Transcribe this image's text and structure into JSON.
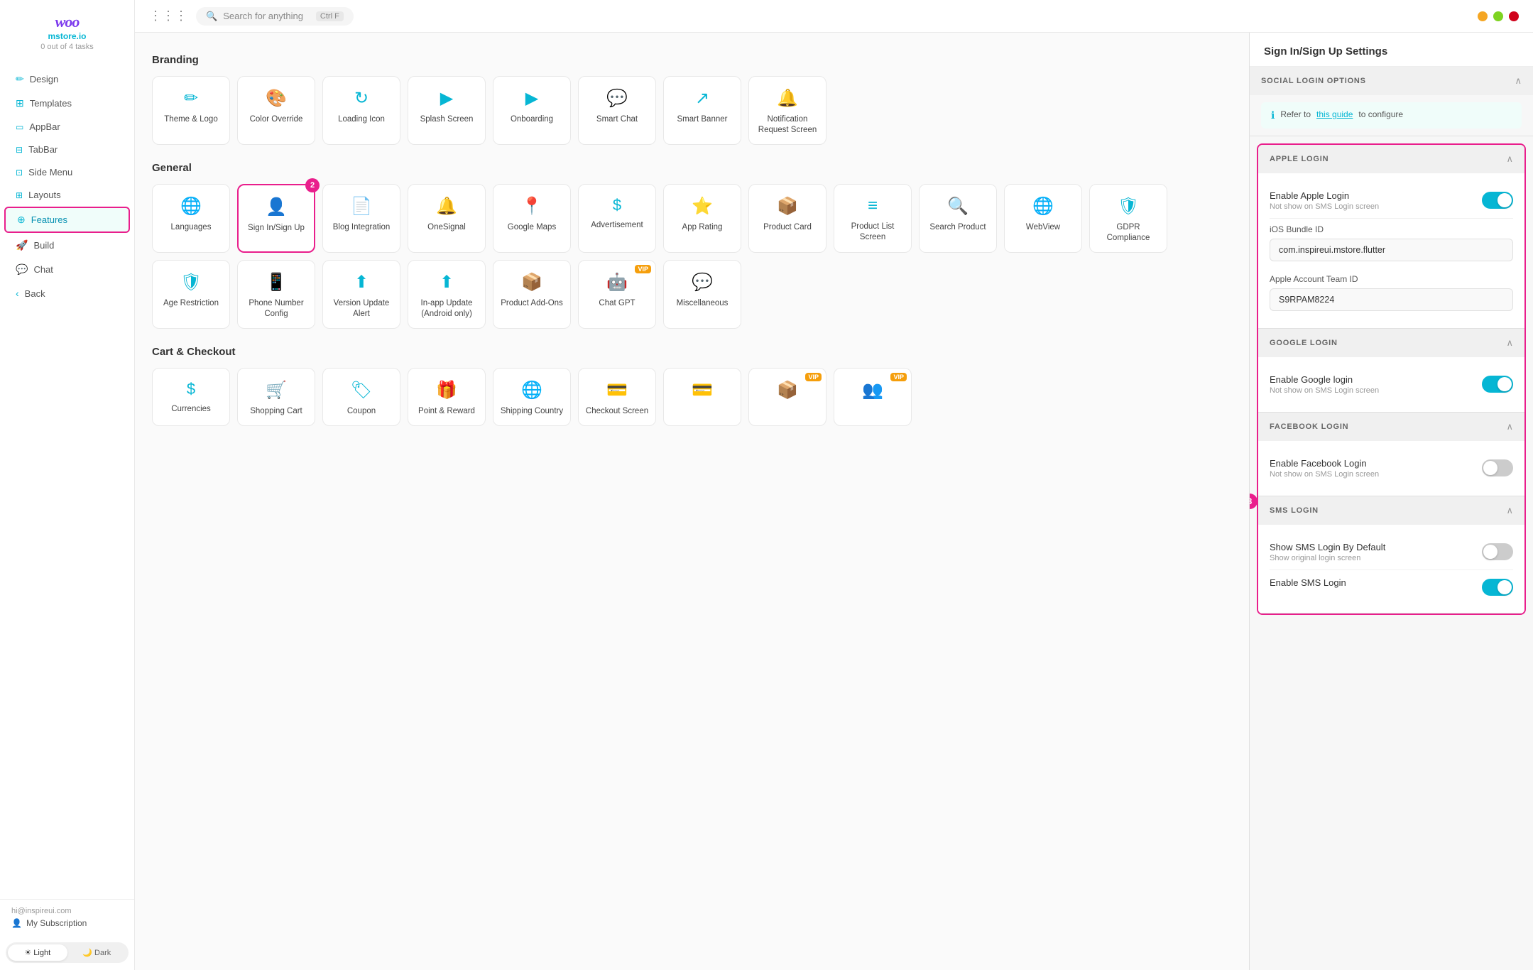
{
  "topbar": {
    "search_placeholder": "Search for anything",
    "shortcut": "Ctrl F",
    "win_buttons": [
      "minimize",
      "maximize",
      "close"
    ]
  },
  "sidebar": {
    "logo": "woo",
    "site": "mstore.io",
    "tasks": "0 out of 4 tasks",
    "nav_items": [
      {
        "id": "design",
        "label": "Design",
        "icon": "✏️"
      },
      {
        "id": "templates",
        "label": "Templates",
        "icon": "⊞"
      },
      {
        "id": "appbar",
        "label": "AppBar",
        "icon": "▭"
      },
      {
        "id": "tabbar",
        "label": "TabBar",
        "icon": "⊟"
      },
      {
        "id": "sidemenu",
        "label": "Side Menu",
        "icon": "⊡"
      },
      {
        "id": "layouts",
        "label": "Layouts",
        "icon": "⊞"
      },
      {
        "id": "features",
        "label": "Features",
        "icon": "⊕",
        "active": true
      },
      {
        "id": "build",
        "label": "Build",
        "icon": "🚀"
      },
      {
        "id": "chat",
        "label": "Chat",
        "icon": "💬"
      },
      {
        "id": "back",
        "label": "Back",
        "icon": "‹"
      }
    ],
    "footer_email": "hi@inspireui.com",
    "subscription_label": "My Subscription",
    "theme_light": "☀ Light",
    "theme_dark": "🌙 Dark"
  },
  "branding": {
    "title": "Branding",
    "items": [
      {
        "id": "theme-logo",
        "label": "Theme & Logo",
        "icon": "✏"
      },
      {
        "id": "color-override",
        "label": "Color Override",
        "icon": "🎨"
      },
      {
        "id": "loading-icon",
        "label": "Loading Icon",
        "icon": "↻"
      },
      {
        "id": "splash-screen",
        "label": "Splash Screen",
        "icon": "▶"
      },
      {
        "id": "onboarding",
        "label": "Onboarding",
        "icon": "▶"
      },
      {
        "id": "smart-chat",
        "label": "Smart Chat",
        "icon": "💬"
      },
      {
        "id": "smart-banner",
        "label": "Smart Banner",
        "icon": "↗"
      },
      {
        "id": "notification-request",
        "label": "Notification Request Screen",
        "icon": "🔔"
      }
    ]
  },
  "general": {
    "title": "General",
    "items": [
      {
        "id": "languages",
        "label": "Languages",
        "icon": "🌐"
      },
      {
        "id": "sign-in-up",
        "label": "Sign In/Sign Up",
        "icon": "👤",
        "selected": true,
        "step": "2"
      },
      {
        "id": "blog-integration",
        "label": "Blog Integration",
        "icon": "📄"
      },
      {
        "id": "onesignal",
        "label": "OneSignal",
        "icon": "🔔"
      },
      {
        "id": "google-maps",
        "label": "Google Maps",
        "icon": "📍"
      },
      {
        "id": "advertisement",
        "label": "Advertisement",
        "icon": "$"
      },
      {
        "id": "app-rating",
        "label": "App Rating",
        "icon": "⭐"
      },
      {
        "id": "product-card",
        "label": "Product Card",
        "icon": "📦"
      },
      {
        "id": "product-list",
        "label": "Product List Screen",
        "icon": "≡"
      },
      {
        "id": "search-product",
        "label": "Search Product",
        "icon": "🔍"
      },
      {
        "id": "webview",
        "label": "WebView",
        "icon": "🌐"
      },
      {
        "id": "gdpr",
        "label": "GDPR Compliance",
        "icon": "🛡"
      },
      {
        "id": "age-restriction",
        "label": "Age Restriction",
        "icon": "🛡"
      },
      {
        "id": "phone-number",
        "label": "Phone Number Config",
        "icon": "📱"
      },
      {
        "id": "version-update",
        "label": "Version Update Alert",
        "icon": "⬆"
      },
      {
        "id": "in-app-update",
        "label": "In-app Update (Android only)",
        "icon": "⬆"
      },
      {
        "id": "product-addons",
        "label": "Product Add-Ons",
        "icon": "📦"
      },
      {
        "id": "chat-gpt",
        "label": "Chat GPT",
        "icon": "🤖",
        "vip": true
      },
      {
        "id": "miscellaneous",
        "label": "Miscellaneous",
        "icon": "💬"
      }
    ]
  },
  "cart_checkout": {
    "title": "Cart & Checkout",
    "items": [
      {
        "id": "currencies",
        "label": "Currencies",
        "icon": "$"
      },
      {
        "id": "shopping-cart",
        "label": "Shopping Cart",
        "icon": "🛒"
      },
      {
        "id": "coupon",
        "label": "Coupon",
        "icon": "🏷"
      },
      {
        "id": "point-reward",
        "label": "Point & Reward",
        "icon": "🎁"
      },
      {
        "id": "shipping-country",
        "label": "Shipping Country",
        "icon": "🌐"
      },
      {
        "id": "checkout-screen",
        "label": "Checkout Screen",
        "icon": "💳"
      },
      {
        "id": "item7",
        "label": "",
        "icon": "💳"
      },
      {
        "id": "item8",
        "label": "",
        "icon": "📦",
        "vip": true
      },
      {
        "id": "item9",
        "label": "",
        "icon": "👥",
        "vip": true
      }
    ]
  },
  "right_panel": {
    "title": "Sign In/Sign Up Settings",
    "social_login_title": "SOCIAL LOGIN OPTIONS",
    "social_info_text": "Refer to ",
    "social_link_text": "this guide",
    "social_info_suffix": " to configure",
    "apple_login": {
      "section_title": "APPLE LOGIN",
      "enable_label": "Enable Apple Login",
      "enable_sub": "Not show on SMS Login screen",
      "enable_value": true,
      "bundle_id_label": "iOS Bundle ID",
      "bundle_id_value": "com.inspireui.mstore.flutter",
      "team_id_label": "Apple Account Team ID",
      "team_id_value": "S9RPAM8224"
    },
    "google_login": {
      "section_title": "GOOGLE LOGIN",
      "enable_label": "Enable Google login",
      "enable_sub": "Not show on SMS Login screen",
      "enable_value": true
    },
    "facebook_login": {
      "section_title": "FACEBOOK LOGIN",
      "enable_label": "Enable Facebook Login",
      "enable_sub": "Not show on SMS Login screen",
      "enable_value": false
    },
    "sms_login": {
      "section_title": "SMS LOGIN",
      "show_default_label": "Show SMS Login By Default",
      "show_default_sub": "Show original login screen",
      "show_default_value": false,
      "enable_sms_label": "Enable SMS Login",
      "enable_sms_value": true
    }
  }
}
